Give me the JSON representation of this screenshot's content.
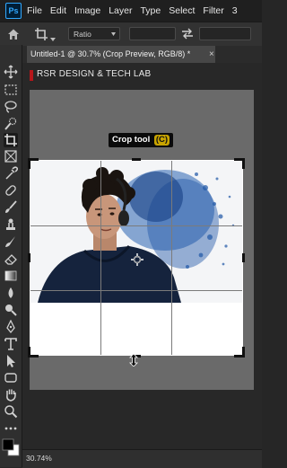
{
  "app": {
    "logo_text": "Ps"
  },
  "menu": {
    "items": [
      "File",
      "Edit",
      "Image",
      "Layer",
      "Type",
      "Select",
      "Filter",
      "3"
    ]
  },
  "options": {
    "ratio_label": "Ratio"
  },
  "document": {
    "tab_title": "Untitled-1 @ 30.7% (Crop Preview, RGB/8) *",
    "close_glyph": "×"
  },
  "canvas": {
    "banner_text": "RSR DESIGN & TECH LAB"
  },
  "tooltip": {
    "label": "Crop tool",
    "shortcut": "(C)"
  },
  "status": {
    "zoom": "30.74%"
  },
  "colors": {
    "banner_mark": "#b5161a",
    "shortcut_badge": "#c8a400",
    "splash": "#1f57a6",
    "workspace": "#262626"
  },
  "tools": [
    "move-icon",
    "marquee-icon",
    "lasso-icon",
    "quick-selection-icon",
    "crop-icon",
    "frame-icon",
    "eyedropper-icon",
    "healing-brush-icon",
    "brush-icon",
    "clone-stamp-icon",
    "history-brush-icon",
    "eraser-icon",
    "gradient-icon",
    "blur-icon",
    "dodge-icon",
    "pen-icon",
    "type-icon",
    "path-selection-icon",
    "rectangle-icon",
    "hand-icon",
    "zoom-icon",
    "more-tools-icon"
  ]
}
